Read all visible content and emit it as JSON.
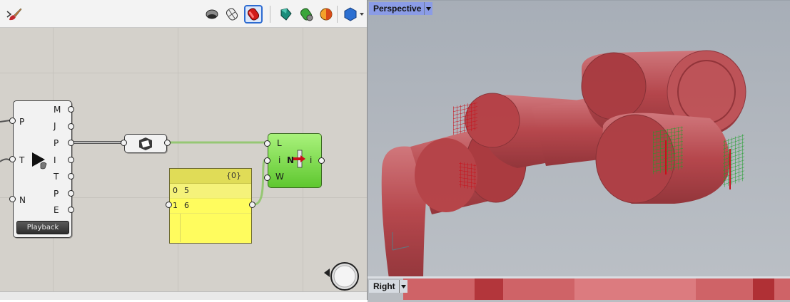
{
  "grasshopper": {
    "toolbar": {
      "icons": [
        "brush-icon",
        "preview-off-icon",
        "preview-wireframe-icon",
        "preview-shaded-icon",
        "preview-selected-icon",
        "document-preview-icon",
        "preview-mesh-quality-icon",
        "custom-preview-icon"
      ]
    },
    "player_component": {
      "inputs": [
        "P",
        "T",
        "N"
      ],
      "outputs": [
        "M",
        "J",
        "P",
        "I",
        "T",
        "P",
        "E"
      ],
      "button_label": "Playback"
    },
    "panel": {
      "header": "{0}",
      "rows": [
        {
          "index": "0",
          "value": "5"
        },
        {
          "index": "1",
          "value": "6"
        }
      ]
    },
    "list_item": {
      "inputs": [
        "L",
        "i",
        "W"
      ],
      "center_label": "N",
      "output": "i"
    }
  },
  "rhino": {
    "viewport_top": {
      "label": "Perspective"
    },
    "viewport_bottom": {
      "label": "Right"
    },
    "colors": {
      "robot": "#c4262b",
      "target_green": "#1e9e2a",
      "target_red": "#c8101a",
      "tab_blue": "#8b9ce6"
    }
  }
}
